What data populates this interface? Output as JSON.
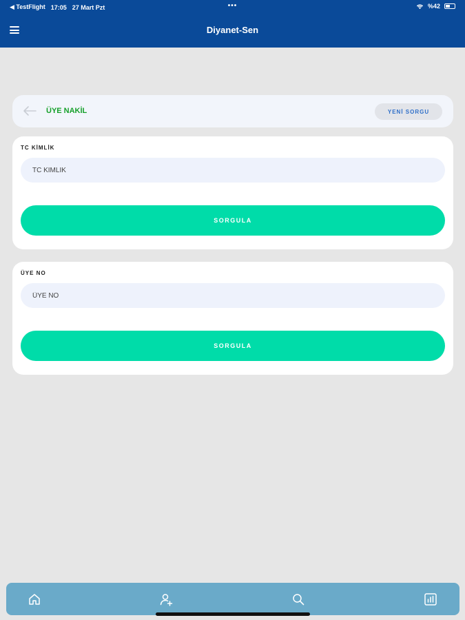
{
  "status_bar": {
    "back_app": "◀ TestFlight",
    "time": "17:05",
    "date": "27 Mart Pzt",
    "dots": "•••",
    "battery": "%42"
  },
  "header": {
    "title": "Diyanet-Sen"
  },
  "top_bar": {
    "title": "ÜYE NAKİL",
    "new_query_label": "YENİ SORGU"
  },
  "forms": [
    {
      "label": "TC KİMLİK",
      "placeholder": "TC KİMLİK",
      "value": "",
      "button_label": "SORGULA"
    },
    {
      "label": "ÜYE NO",
      "placeholder": "ÜYE NO",
      "value": "",
      "button_label": "SORGULA"
    }
  ],
  "tab_bar": {
    "items": [
      {
        "icon": "home-icon"
      },
      {
        "icon": "add-user-icon"
      },
      {
        "icon": "search-icon"
      },
      {
        "icon": "chart-icon"
      }
    ]
  },
  "colors": {
    "header": "#0a4a99",
    "accent_green": "#00dca9",
    "title_green": "#16a02a",
    "tabbar": "#6aaac9"
  }
}
